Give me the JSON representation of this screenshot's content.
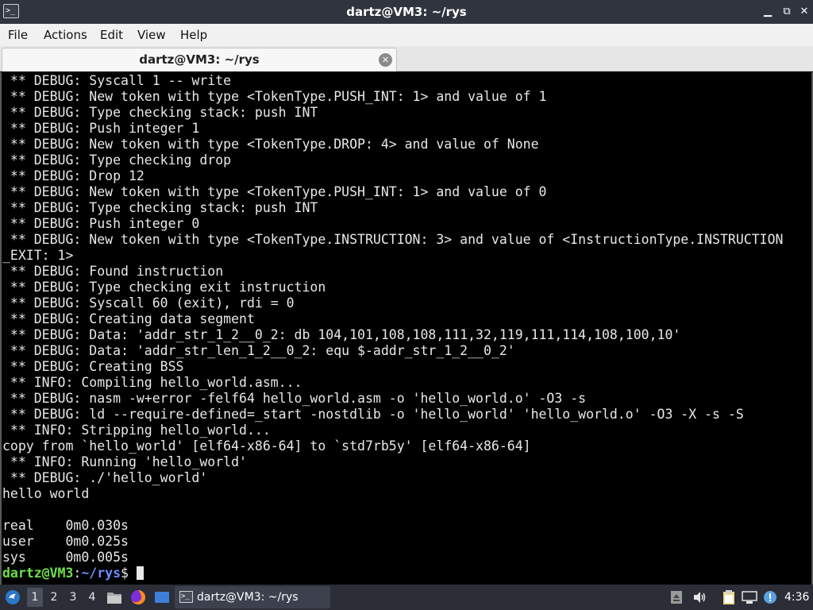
{
  "window": {
    "title": "dartz@VM3: ~/rys",
    "icon": "terminal-icon",
    "buttons": {
      "minimize": "▁",
      "restore": "⧉",
      "close": "✕"
    }
  },
  "menu": [
    "File",
    "Actions",
    "Edit",
    "View",
    "Help"
  ],
  "tab": {
    "label": "dartz@VM3: ~/rys",
    "close_glyph": "✕"
  },
  "terminal": {
    "lines": [
      " ** DEBUG: Syscall 1 -- write",
      " ** DEBUG: New token with type <TokenType.PUSH_INT: 1> and value of 1",
      " ** DEBUG: Type checking stack: push INT",
      " ** DEBUG: Push integer 1",
      " ** DEBUG: New token with type <TokenType.DROP: 4> and value of None",
      " ** DEBUG: Type checking drop",
      " ** DEBUG: Drop 12",
      " ** DEBUG: New token with type <TokenType.PUSH_INT: 1> and value of 0",
      " ** DEBUG: Type checking stack: push INT",
      " ** DEBUG: Push integer 0",
      " ** DEBUG: New token with type <TokenType.INSTRUCTION: 3> and value of <InstructionType.INSTRUCTION",
      "_EXIT: 1>",
      " ** DEBUG: Found instruction",
      " ** DEBUG: Type checking exit instruction",
      " ** DEBUG: Syscall 60 (exit), rdi = 0",
      " ** DEBUG: Creating data segment",
      " ** DEBUG: Data: 'addr_str_1_2__0_2: db 104,101,108,108,111,32,119,111,114,108,100,10'",
      " ** DEBUG: Data: 'addr_str_len_1_2__0_2: equ $-addr_str_1_2__0_2'",
      " ** DEBUG: Creating BSS",
      " ** INFO: Compiling hello_world.asm...",
      " ** DEBUG: nasm -w+error -felf64 hello_world.asm -o 'hello_world.o' -O3 -s",
      " ** DEBUG: ld --require-defined=_start -nostdlib -o 'hello_world' 'hello_world.o' -O3 -X -s -S",
      " ** INFO: Stripping hello_world...",
      "copy from `hello_world' [elf64-x86-64] to `std7rb5y' [elf64-x86-64]",
      " ** INFO: Running 'hello_world'",
      " ** DEBUG: ./'hello_world'",
      "hello world",
      "",
      "real    0m0.030s",
      "user    0m0.025s",
      "sys     0m0.005s"
    ],
    "prompt": {
      "user_host": "dartz@VM3",
      "sep": ":",
      "path": "~/rys",
      "symbol": "$ "
    }
  },
  "taskbar": {
    "workspaces": [
      "1",
      "2",
      "3",
      "4"
    ],
    "active_workspace": "1",
    "task_label": "dartz@VM3: ~/rys",
    "clock": "4:36"
  }
}
